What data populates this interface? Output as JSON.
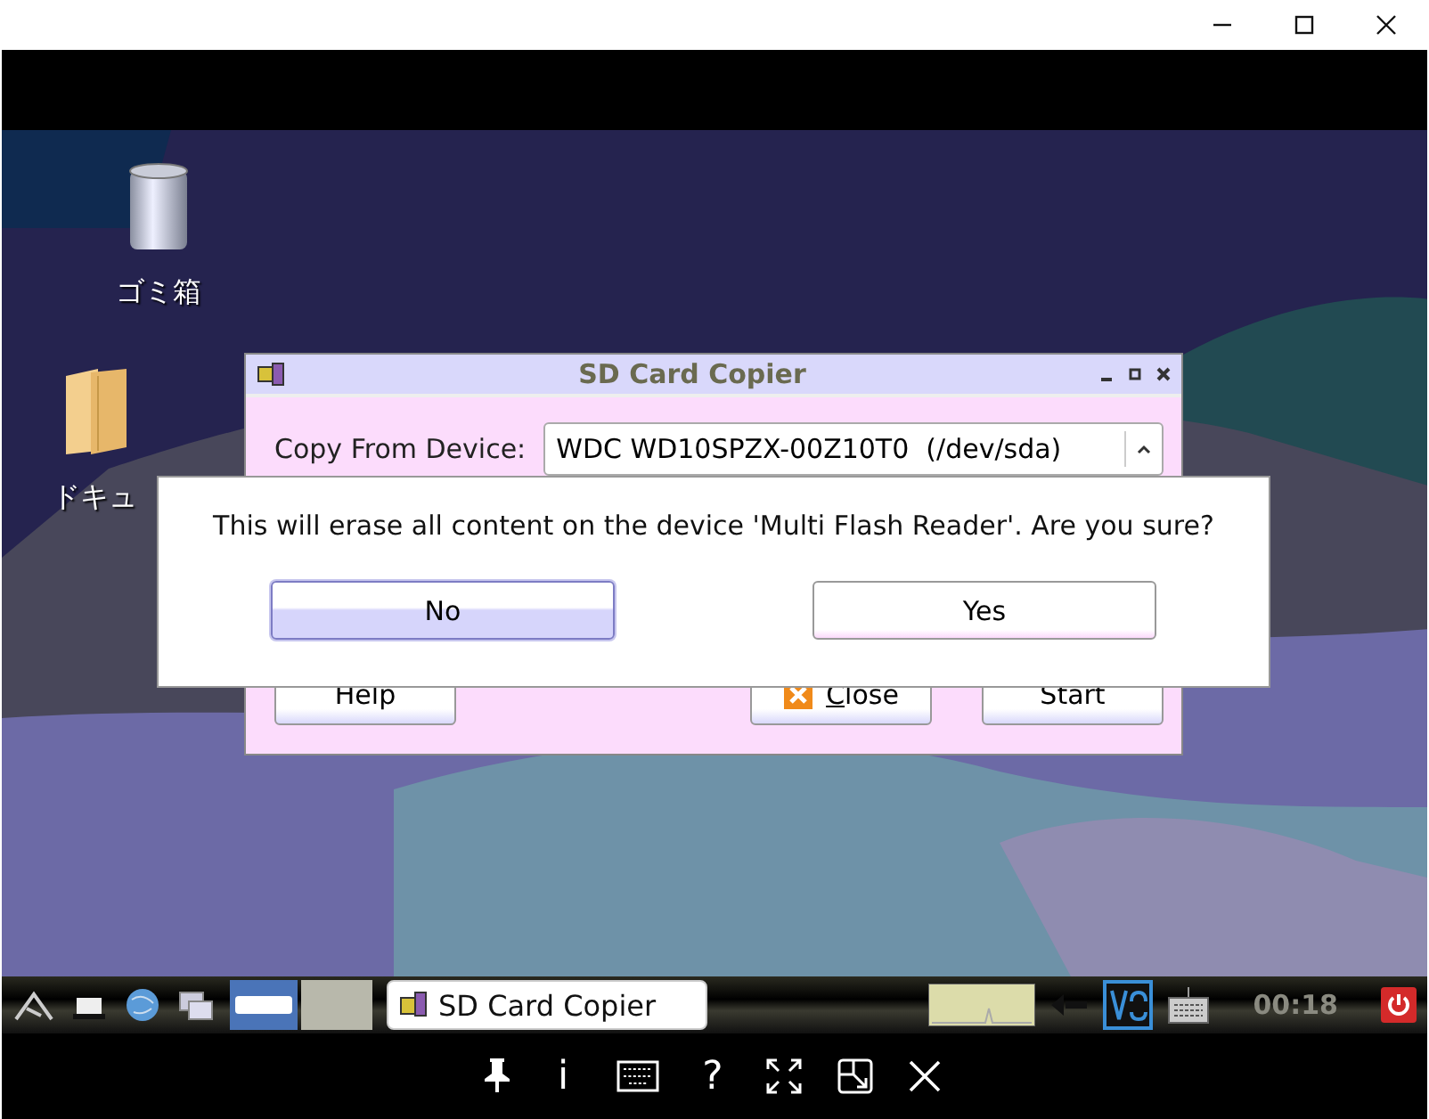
{
  "desktop": {
    "icons": [
      {
        "kind": "trash",
        "label": "ゴミ箱"
      },
      {
        "kind": "folder",
        "label": "ドキュ"
      }
    ]
  },
  "copier_window": {
    "title": "SD Card Copier",
    "field_label": "Copy From Device:",
    "device": "WDC WD10SPZX-00Z10T0  (/dev/sda)",
    "buttons": [
      {
        "kind": "plain",
        "label": "Help"
      },
      {
        "kind": "close",
        "label": "Close"
      },
      {
        "kind": "plain",
        "label": "Start"
      }
    ]
  },
  "dialog": {
    "message": "This will erase all content on the device 'Multi Flash Reader'. Are you sure?",
    "buttons": [
      {
        "label": "No",
        "selected": true
      },
      {
        "label": "Yes",
        "selected": false
      }
    ]
  },
  "taskbar": {
    "task": "SD Card Copier",
    "clock": "00:18"
  },
  "viewer_toolbar": [
    {
      "kind": "pin"
    },
    {
      "kind": "glyph",
      "text": "i"
    },
    {
      "kind": "keyboard"
    },
    {
      "kind": "glyph",
      "text": "?"
    },
    {
      "kind": "fullscreen"
    },
    {
      "kind": "scale"
    },
    {
      "kind": "close"
    }
  ]
}
